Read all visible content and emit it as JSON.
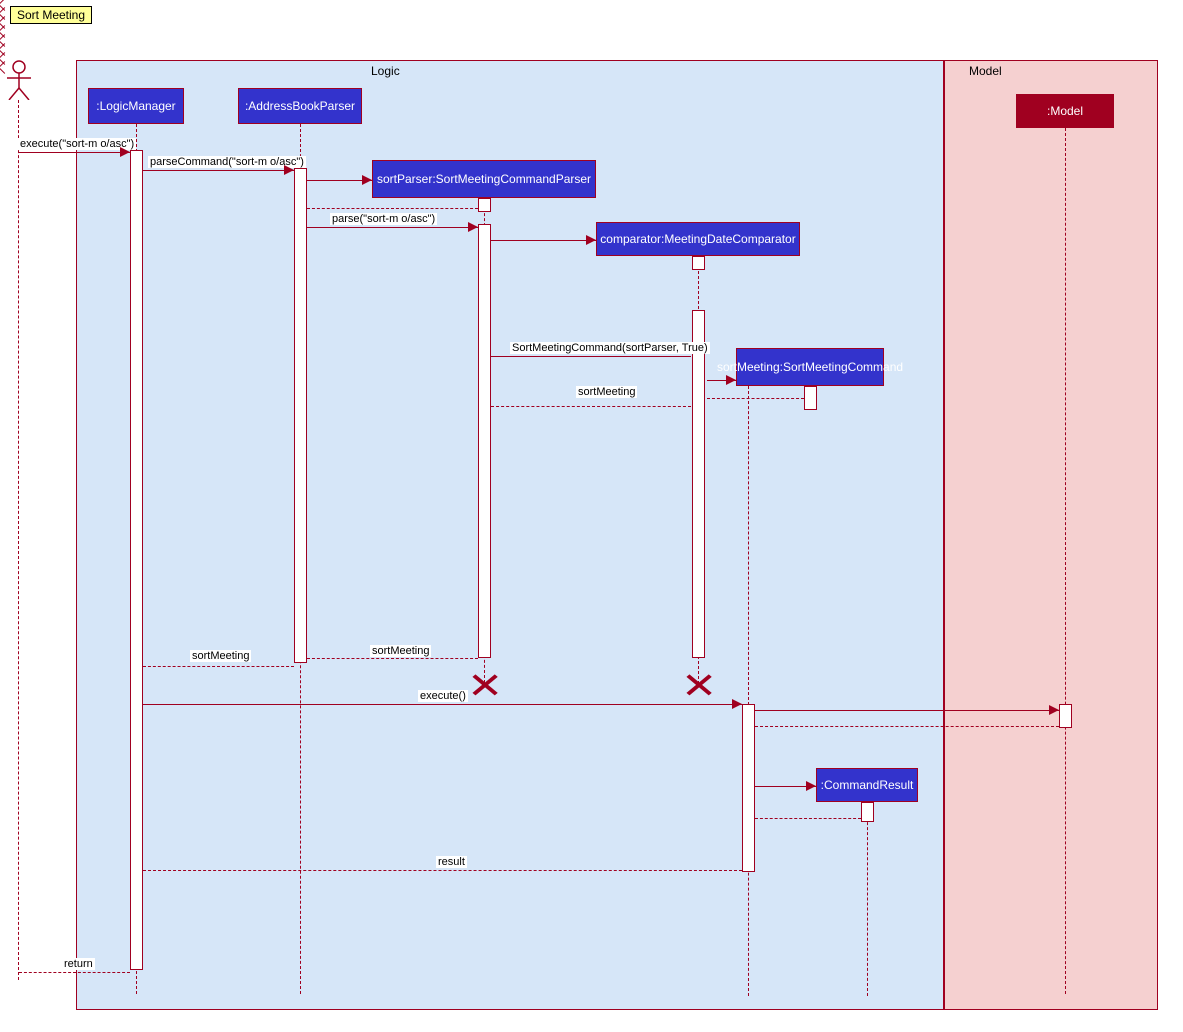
{
  "title": "Sort Meeting",
  "frames": {
    "logic": "Logic",
    "model": "Model"
  },
  "participants": {
    "logicManager": ":LogicManager",
    "addressBookParser": ":AddressBookParser",
    "sortParser": "sortParser:SortMeetingCommandParser",
    "comparator": "comparator:MeetingDateComparator",
    "sortMeeting": "sortMeeting:SortMeetingCommand",
    "commandResult": ":CommandResult",
    "model": ":Model"
  },
  "messages": {
    "execute": "execute(\"sort-m o/asc\")",
    "parseCommand": "parseCommand(\"sort-m o/asc\")",
    "parse": "parse(\"sort-m o/asc\")",
    "sortMeetingCommand": "SortMeetingCommand(sortParser, True)",
    "sortMeetingReturn": "sortMeeting",
    "sortMeetingReturn2": "sortMeeting",
    "sortMeetingReturn3": "sortMeeting",
    "executeBlank": "execute()",
    "result": "result",
    "return": "return"
  },
  "chart_data": {
    "type": "uml_sequence_diagram",
    "title": "Sort Meeting",
    "frames": [
      {
        "name": "Logic",
        "participants": [
          ":LogicManager",
          ":AddressBookParser",
          "sortParser:SortMeetingCommandParser",
          "comparator:MeetingDateComparator",
          "sortMeeting:SortMeetingCommand",
          ":CommandResult"
        ]
      },
      {
        "name": "Model",
        "participants": [
          ":Model"
        ]
      }
    ],
    "actor": "User",
    "lifelines": [
      {
        "name": "Actor",
        "type": "actor"
      },
      {
        "name": ":LogicManager",
        "frame": "Logic",
        "style": "blue"
      },
      {
        "name": ":AddressBookParser",
        "frame": "Logic",
        "style": "blue"
      },
      {
        "name": "sortParser:SortMeetingCommandParser",
        "frame": "Logic",
        "style": "blue",
        "created_by_message": 3,
        "destroyed": true
      },
      {
        "name": "comparator:MeetingDateComparator",
        "frame": "Logic",
        "style": "blue",
        "created_by_message": 5,
        "destroyed": true
      },
      {
        "name": "sortMeeting:SortMeetingCommand",
        "frame": "Logic",
        "style": "blue",
        "created_by_message": 6
      },
      {
        "name": ":CommandResult",
        "frame": "Logic",
        "style": "blue",
        "created_by_message": 13
      },
      {
        "name": ":Model",
        "frame": "Model",
        "style": "red"
      }
    ],
    "messages": [
      {
        "seq": 1,
        "from": "Actor",
        "to": ":LogicManager",
        "label": "execute(\"sort-m o/asc\")",
        "type": "sync"
      },
      {
        "seq": 2,
        "from": ":LogicManager",
        "to": ":AddressBookParser",
        "label": "parseCommand(\"sort-m o/asc\")",
        "type": "sync"
      },
      {
        "seq": 3,
        "from": ":AddressBookParser",
        "to": "sortParser:SortMeetingCommandParser",
        "label": "",
        "type": "create"
      },
      {
        "seq": 4,
        "from": ":AddressBookParser",
        "to": "sortParser:SortMeetingCommandParser",
        "label": "parse(\"sort-m o/asc\")",
        "type": "sync"
      },
      {
        "seq": 5,
        "from": "sortParser:SortMeetingCommandParser",
        "to": "comparator:MeetingDateComparator",
        "label": "",
        "type": "create"
      },
      {
        "seq": 6,
        "from": "sortParser:SortMeetingCommandParser",
        "to": "sortMeeting:SortMeetingCommand",
        "label": "SortMeetingCommand(sortParser, True)",
        "type": "sync"
      },
      {
        "seq": 7,
        "from": "sortMeeting:SortMeetingCommand",
        "to": "sortParser:SortMeetingCommandParser",
        "label": "sortMeeting",
        "type": "return"
      },
      {
        "seq": 8,
        "from": "sortParser:SortMeetingCommandParser",
        "to": ":AddressBookParser",
        "label": "sortMeeting",
        "type": "return"
      },
      {
        "seq": 9,
        "from": ":AddressBookParser",
        "to": ":LogicManager",
        "label": "sortMeeting",
        "type": "return"
      },
      {
        "seq": 10,
        "from": "sortParser:SortMeetingCommandParser",
        "type": "destroy"
      },
      {
        "seq": 11,
        "from": "comparator:MeetingDateComparator",
        "type": "destroy"
      },
      {
        "seq": 12,
        "from": ":LogicManager",
        "to": ":Model",
        "label": "execute()",
        "type": "sync",
        "via": "sortMeeting:SortMeetingCommand"
      },
      {
        "seq": 13,
        "from": ":Model",
        "to": "sortMeeting:SortMeetingCommand",
        "label": "",
        "type": "return"
      },
      {
        "seq": 14,
        "from": "sortMeeting:SortMeetingCommand",
        "to": ":CommandResult",
        "label": "",
        "type": "create"
      },
      {
        "seq": 15,
        "from": ":CommandResult",
        "to": "sortMeeting:SortMeetingCommand",
        "label": "",
        "type": "return"
      },
      {
        "seq": 16,
        "from": "sortMeeting:SortMeetingCommand",
        "to": ":LogicManager",
        "label": "result",
        "type": "return"
      },
      {
        "seq": 17,
        "from": ":LogicManager",
        "to": "Actor",
        "label": "return",
        "type": "return"
      }
    ]
  }
}
